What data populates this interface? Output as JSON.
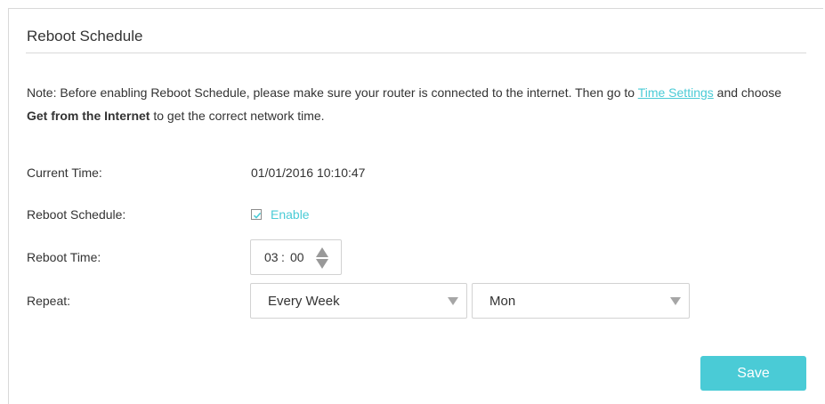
{
  "section": {
    "title": "Reboot Schedule"
  },
  "note": {
    "prefix": "Note: Before enabling Reboot Schedule, please make sure your router is connected to the internet. Then go to ",
    "link_text": "Time Settings",
    "middle": " and choose ",
    "bold": "Get from the Internet",
    "suffix": " to get the correct network time."
  },
  "fields": {
    "current_time_label": "Current Time:",
    "current_time_value": "01/01/2016 10:10:47",
    "reboot_schedule_label": "Reboot Schedule:",
    "enable_label": "Enable",
    "enable_checked": true,
    "reboot_time_label": "Reboot Time:",
    "reboot_time_hour": "03",
    "reboot_time_sep": ":",
    "reboot_time_minute": "00",
    "repeat_label": "Repeat:",
    "repeat_selected": "Every Week",
    "day_selected": "Mon"
  },
  "actions": {
    "save_label": "Save"
  },
  "colors": {
    "accent": "#4acbd6",
    "text": "#333333",
    "border": "#d2d2d2"
  },
  "icons": {
    "checkbox": "check-icon",
    "spinner_up": "triangle-up-icon",
    "spinner_down": "triangle-down-icon",
    "select_caret": "caret-down-icon"
  }
}
